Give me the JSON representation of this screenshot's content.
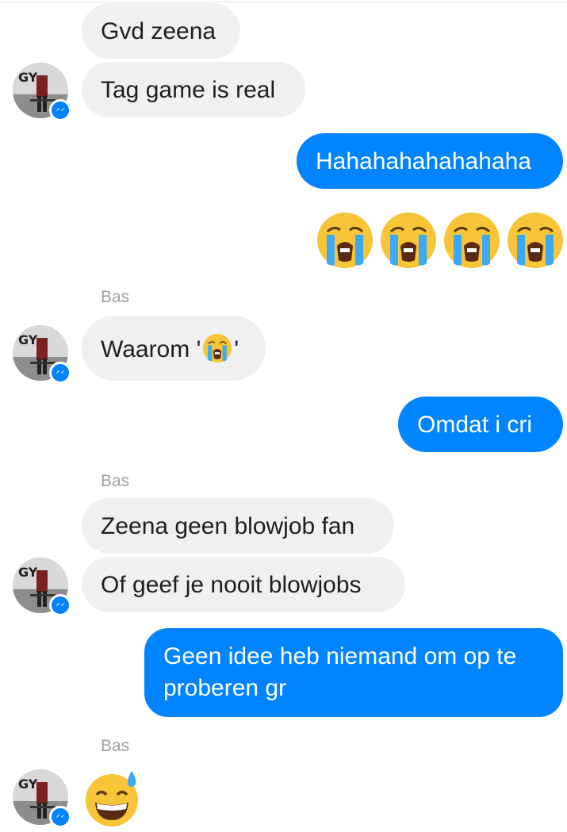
{
  "conversation": {
    "sender_name": "Bas",
    "messages": [
      {
        "side": "in",
        "text": "Gvd zeena"
      },
      {
        "side": "in",
        "text": "Tag game is real"
      },
      {
        "side": "out",
        "text": "Hahahahahahahaha"
      },
      {
        "side": "out",
        "emoji": "loudly-crying-face",
        "count": 4
      },
      {
        "side": "in",
        "text_before": "Waarom '",
        "emoji": "loudly-crying-face",
        "text_after": "'"
      },
      {
        "side": "out",
        "text": "Omdat i cri"
      },
      {
        "side": "in",
        "text": "Zeena geen blowjob fan"
      },
      {
        "side": "in",
        "text": "Of geef je nooit blowjobs"
      },
      {
        "side": "out",
        "text": "Geen idee heb niemand om op te proberen gr"
      },
      {
        "side": "in",
        "emoji": "grinning-face-with-sweat"
      }
    ]
  },
  "avatar": {
    "icon": "avatar",
    "badge_icon": "messenger-badge-icon"
  },
  "colors": {
    "outgoing": "#0084ff",
    "incoming": "#f1f0f0",
    "sender": "#a0a0a0"
  }
}
